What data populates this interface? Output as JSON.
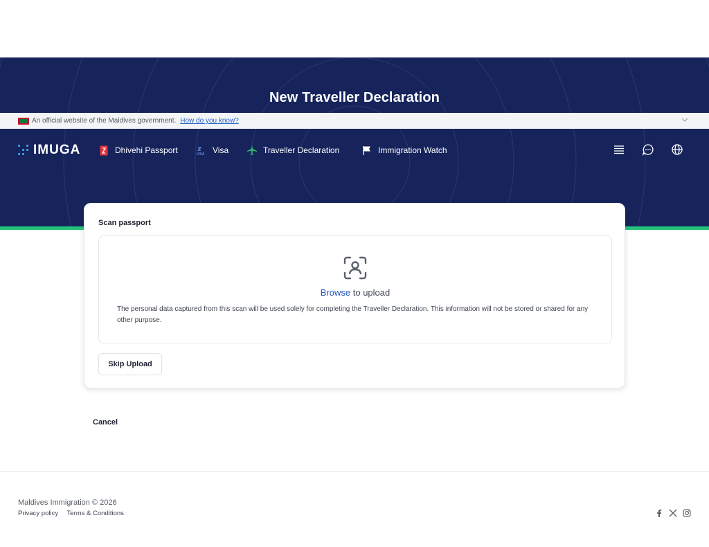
{
  "page": {
    "title": "New Traveller Declaration"
  },
  "gov_banner": {
    "text": "An official website of the Maldives government.",
    "link": "How do you know?"
  },
  "nav": {
    "logo": "IMUGA",
    "items": [
      {
        "label": "Dhivehi Passport",
        "icon": "passport-icon"
      },
      {
        "label": "Visa",
        "icon": "visa-icon"
      },
      {
        "label": "Traveller Declaration",
        "icon": "airplane-icon"
      },
      {
        "label": "Immigration Watch",
        "icon": "flag-icon"
      }
    ],
    "right_icons": [
      "list-icon",
      "chat-icon",
      "globe-icon"
    ]
  },
  "scan": {
    "title": "Scan passport",
    "browse": "Browse",
    "upload_text": " to upload",
    "note": "The personal data captured from this scan will be used solely for completing the Traveller Declaration. This information will not be stored or shared for any other purpose.",
    "skip": "Skip Upload"
  },
  "actions": {
    "cancel": "Cancel"
  },
  "footer": {
    "copyright": "Maldives Immigration © 2026",
    "privacy": "Privacy policy",
    "terms": "Terms & Conditions",
    "social": [
      "facebook-icon",
      "x-icon",
      "instagram-icon"
    ]
  },
  "colors": {
    "hero": "#17245c",
    "accent_green": "#23c47a",
    "link_blue": "#2457c5"
  }
}
